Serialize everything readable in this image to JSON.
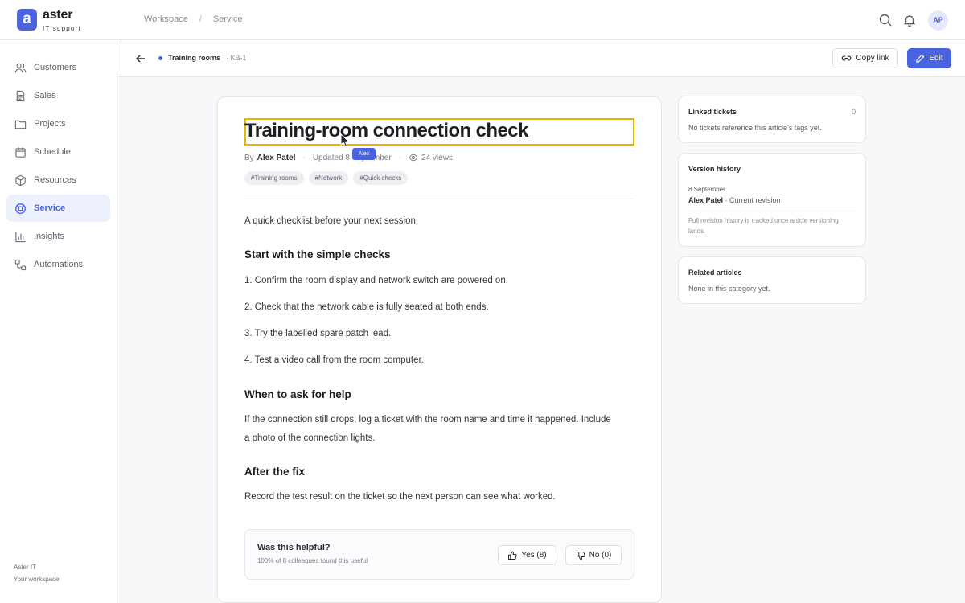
{
  "brand": {
    "logo_letter": "a",
    "name": "aster",
    "subtitle": "IT support"
  },
  "breadcrumb": [
    "Workspace",
    "/",
    "Service"
  ],
  "user": {
    "initials": "AP"
  },
  "sidebar": {
    "items": [
      {
        "label": "Customers",
        "icon": "users-icon"
      },
      {
        "label": "Sales",
        "icon": "document-icon"
      },
      {
        "label": "Projects",
        "icon": "folder-icon"
      },
      {
        "label": "Schedule",
        "icon": "calendar-icon"
      },
      {
        "label": "Resources",
        "icon": "box-icon"
      },
      {
        "label": "Service",
        "icon": "lifebuoy-icon",
        "active": true
      },
      {
        "label": "Insights",
        "icon": "bar-chart-icon"
      },
      {
        "label": "Automations",
        "icon": "workflow-icon"
      }
    ],
    "footer_title": "Aster IT",
    "footer_sub": "Your workspace"
  },
  "subheader": {
    "category": "Training rooms",
    "article_id": "· KB-1",
    "copy_label": "Copy link",
    "edit_label": "Edit"
  },
  "article": {
    "title": "Training-room connection check",
    "by_label": "By",
    "author": "Alex Patel",
    "updated": "Updated 8 September",
    "views": "24 views",
    "tooltip": "Alex",
    "tags": [
      "#Training rooms",
      "#Network",
      "#Quick checks"
    ],
    "intro": "A quick checklist before your next session.",
    "h1": "Start with the simple checks",
    "steps": [
      "1. Confirm the room display and network switch are powered on.",
      "2. Check that the network cable is fully seated at both ends.",
      "3. Try the labelled spare patch lead.",
      "4. Test a video call from the room computer."
    ],
    "h2": "When to ask for help",
    "help_line1": "If the connection still drops, log a ticket with the room name and time it happened. Include",
    "help_line2": "a photo of the connection lights.",
    "h3": "After the fix",
    "fix": "Record the test result on the ticket so the next person can see what worked."
  },
  "feedback": {
    "question": "Was this helpful?",
    "summary": "100% of 8 colleagues found this useful",
    "yes_label": "Yes (8)",
    "no_label": "No (0)"
  },
  "panels": {
    "linked": {
      "title": "Linked tickets",
      "count": "0",
      "text": "No tickets reference this article's tags yet."
    },
    "history": {
      "title": "Version history",
      "date": "8 September",
      "author": "Alex Patel",
      "revision": " · Current revision",
      "note": "Full revision history is tracked once article versioning lands."
    },
    "related": {
      "title": "Related articles",
      "text": "None in this category yet."
    }
  },
  "colors": {
    "accent": "#4a63e0",
    "highlight": "#e8b400"
  }
}
